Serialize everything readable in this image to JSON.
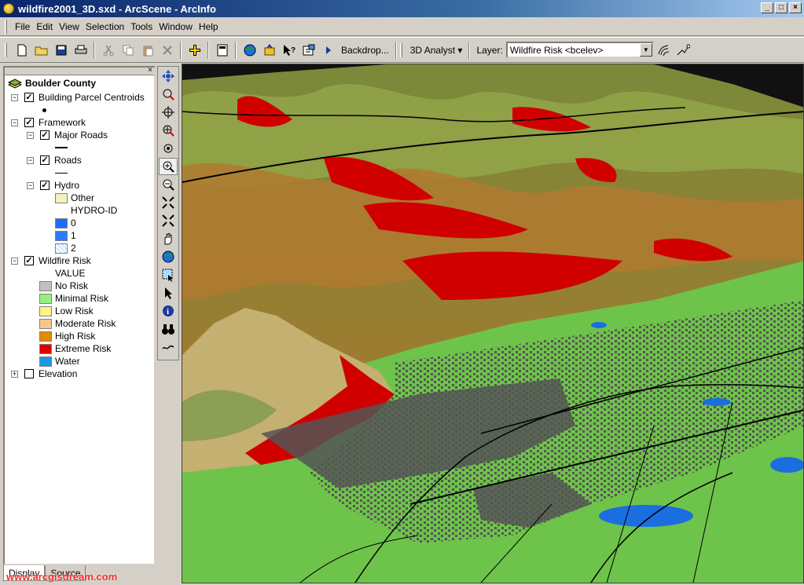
{
  "window": {
    "title": "wildfire2001_3D.sxd - ArcScene - ArcInfo"
  },
  "menubar": {
    "items": [
      "File",
      "Edit",
      "View",
      "Selection",
      "Tools",
      "Window",
      "Help"
    ]
  },
  "toolbar": {
    "backdrop_label": "Backdrop...",
    "analyst_label": "3D Analyst",
    "layer_label": "Layer:",
    "layer_value": "Wildfire Risk <bcelev>"
  },
  "toc": {
    "root": "Boulder County",
    "layers": [
      {
        "name": "Building Parcel Centroids",
        "checked": true
      },
      {
        "name": "Framework",
        "checked": true
      },
      {
        "name": "Major Roads",
        "checked": true
      },
      {
        "name": "Roads",
        "checked": true
      },
      {
        "name": "Hydro",
        "checked": true
      },
      {
        "name": "Wildfire Risk",
        "checked": true
      },
      {
        "name": "Elevation",
        "checked": false
      }
    ],
    "hydro": {
      "other_label": "Other",
      "field": "HYDRO-ID",
      "classes": [
        "0",
        "1",
        "2"
      ],
      "colors": [
        "#f5f0c0",
        "#1e6cff",
        "#2b7bff",
        "#cce8ff"
      ]
    },
    "wildfire": {
      "field": "VALUE",
      "classes": [
        {
          "label": "No Risk",
          "color": "#c0c0c0"
        },
        {
          "label": "Minimal Risk",
          "color": "#96f07a"
        },
        {
          "label": "Low Risk",
          "color": "#fff582"
        },
        {
          "label": "Moderate Risk",
          "color": "#f5c78a"
        },
        {
          "label": "High Risk",
          "color": "#e08c00"
        },
        {
          "label": "Extreme Risk",
          "color": "#e00000"
        },
        {
          "label": "Water",
          "color": "#1a98e6"
        }
      ]
    }
  },
  "tabs": [
    "Display",
    "Source"
  ],
  "watermark": "www.arcgisdream.com"
}
